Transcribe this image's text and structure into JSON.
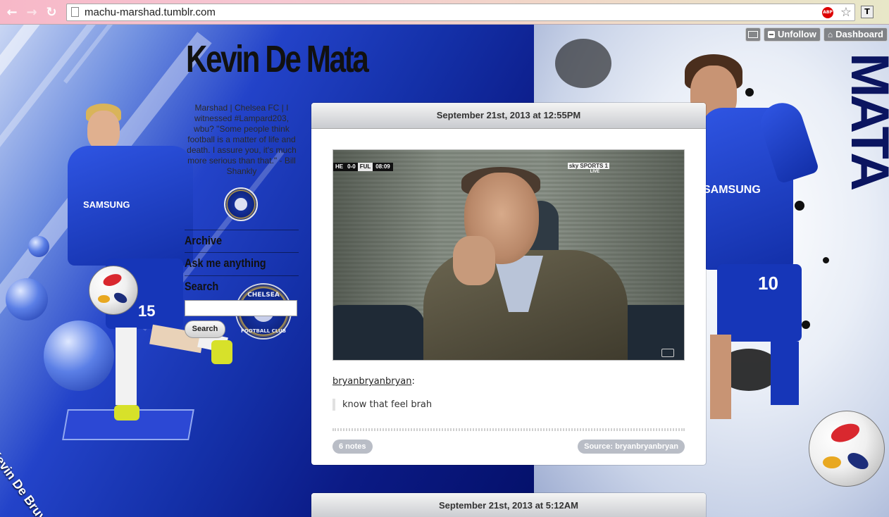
{
  "browser": {
    "url": "machu-marshad.tumblr.com",
    "abp_label": "ABP",
    "ext_label": "T"
  },
  "tumblr_controls": {
    "unfollow": "Unfollow",
    "dashboard": "Dashboard"
  },
  "sidebar": {
    "title": "Kevin De Mata",
    "description": "Marshad | Chelsea FC | I witnessed #Lampard203, wbu? \"Some people think football is a matter of life and death. I assure you, it's much more serious than that.\" - Bill Shankly",
    "links": [
      "Archive",
      "Ask me anything",
      "Search"
    ],
    "search_button": "Search",
    "crest_text": "CHELSEA",
    "crest_text_2": "FOOTBALL CLUB"
  },
  "background": {
    "left_player_name": "Kevin De Bruyne",
    "right_vertical_text": "MATA",
    "shirt_sponsor": "SAMSUNG",
    "left_shirt_number": "15",
    "right_shirt_number": "10"
  },
  "posts": [
    {
      "date": "September 21st, 2013 at 12:55PM",
      "photo": {
        "score_home": "HE",
        "score": "0-0",
        "score_away": "FUL",
        "clock": "08:09",
        "channel": "sky SPORTS 1",
        "channel_sub": "LIVE"
      },
      "source_user": "bryanbryanbryan",
      "quote": "know that feel brah",
      "notes": "6 notes",
      "source": "Source: bryanbryanbryan"
    },
    {
      "date": "September 21st, 2013 at 5:12AM"
    }
  ],
  "colors": {
    "blue_dark": "#0b1a85",
    "pill": "#b9bdc6"
  }
}
